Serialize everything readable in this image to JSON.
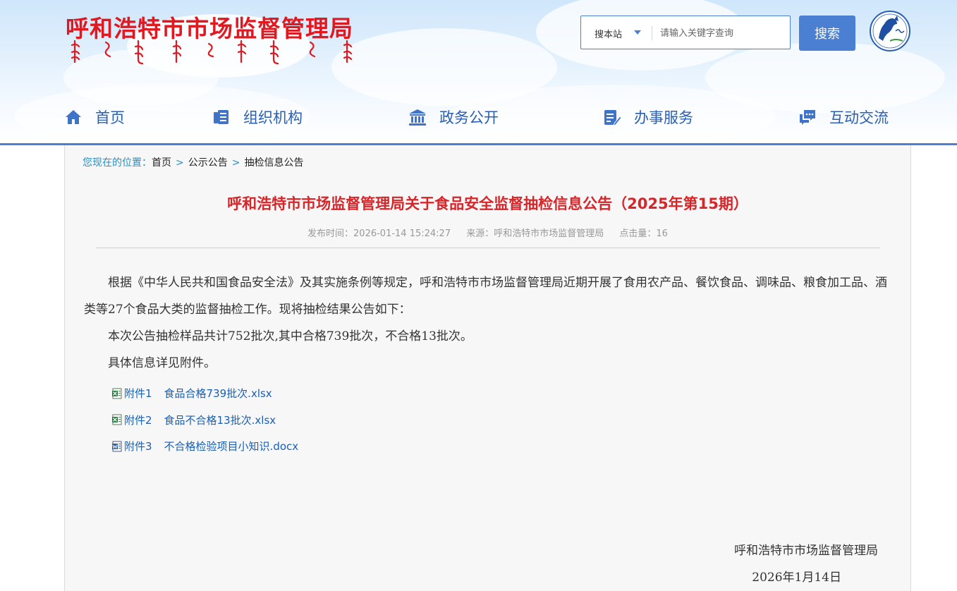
{
  "header": {
    "site_title": "呼和浩特市市场监督管理局",
    "search": {
      "scope": "搜本站",
      "placeholder": "请输入关键字查询",
      "button": "搜索"
    }
  },
  "nav": [
    {
      "label": "首页",
      "icon": "home-icon"
    },
    {
      "label": "组织机构",
      "icon": "organization-icon"
    },
    {
      "label": "政务公开",
      "icon": "government-building-icon"
    },
    {
      "label": "办事服务",
      "icon": "service-form-icon"
    },
    {
      "label": "互动交流",
      "icon": "chat-icon"
    }
  ],
  "breadcrumb": {
    "prefix": "您现在的位置：",
    "items": [
      "首页",
      "公示公告",
      "抽检信息公告"
    ],
    "separator": ">"
  },
  "article": {
    "title": "呼和浩特市市场监督管理局关于食品安全监督抽检信息公告（2025年第15期）",
    "meta": {
      "publish_time": "发布时间：2026-01-14 15:24:27",
      "source": "来源：呼和浩特市市场监督管理局",
      "hits": "点击量：16"
    },
    "paragraphs": [
      "根据《中华人民共和国食品安全法》及其实施条例等规定，呼和浩特市市场监督管理局近期开展了食用农产品、餐饮食品、调味品、粮食加工品、酒类等27个食品大类的监督抽检工作。现将抽检结果公告如下：",
      "本次公告抽检样品共计752批次,其中合格739批次，不合格13批次。",
      "具体信息详见附件。"
    ],
    "attachments": [
      {
        "label": "附件1",
        "name": "食品合格739批次.xlsx",
        "icon": "excel-file-icon"
      },
      {
        "label": "附件2",
        "name": "食品不合格13批次.xlsx",
        "icon": "excel-file-icon"
      },
      {
        "label": "附件3",
        "name": "不合格检验项目小知识.docx",
        "icon": "word-file-icon"
      }
    ],
    "signature": {
      "org": "呼和浩特市市场监督管理局",
      "date": "2026年1月14日"
    }
  },
  "colors": {
    "brand_blue": "#4a7fd1",
    "title_red": "#d6262a",
    "header_red": "#e0181f",
    "link_blue": "#1a5fb4"
  }
}
